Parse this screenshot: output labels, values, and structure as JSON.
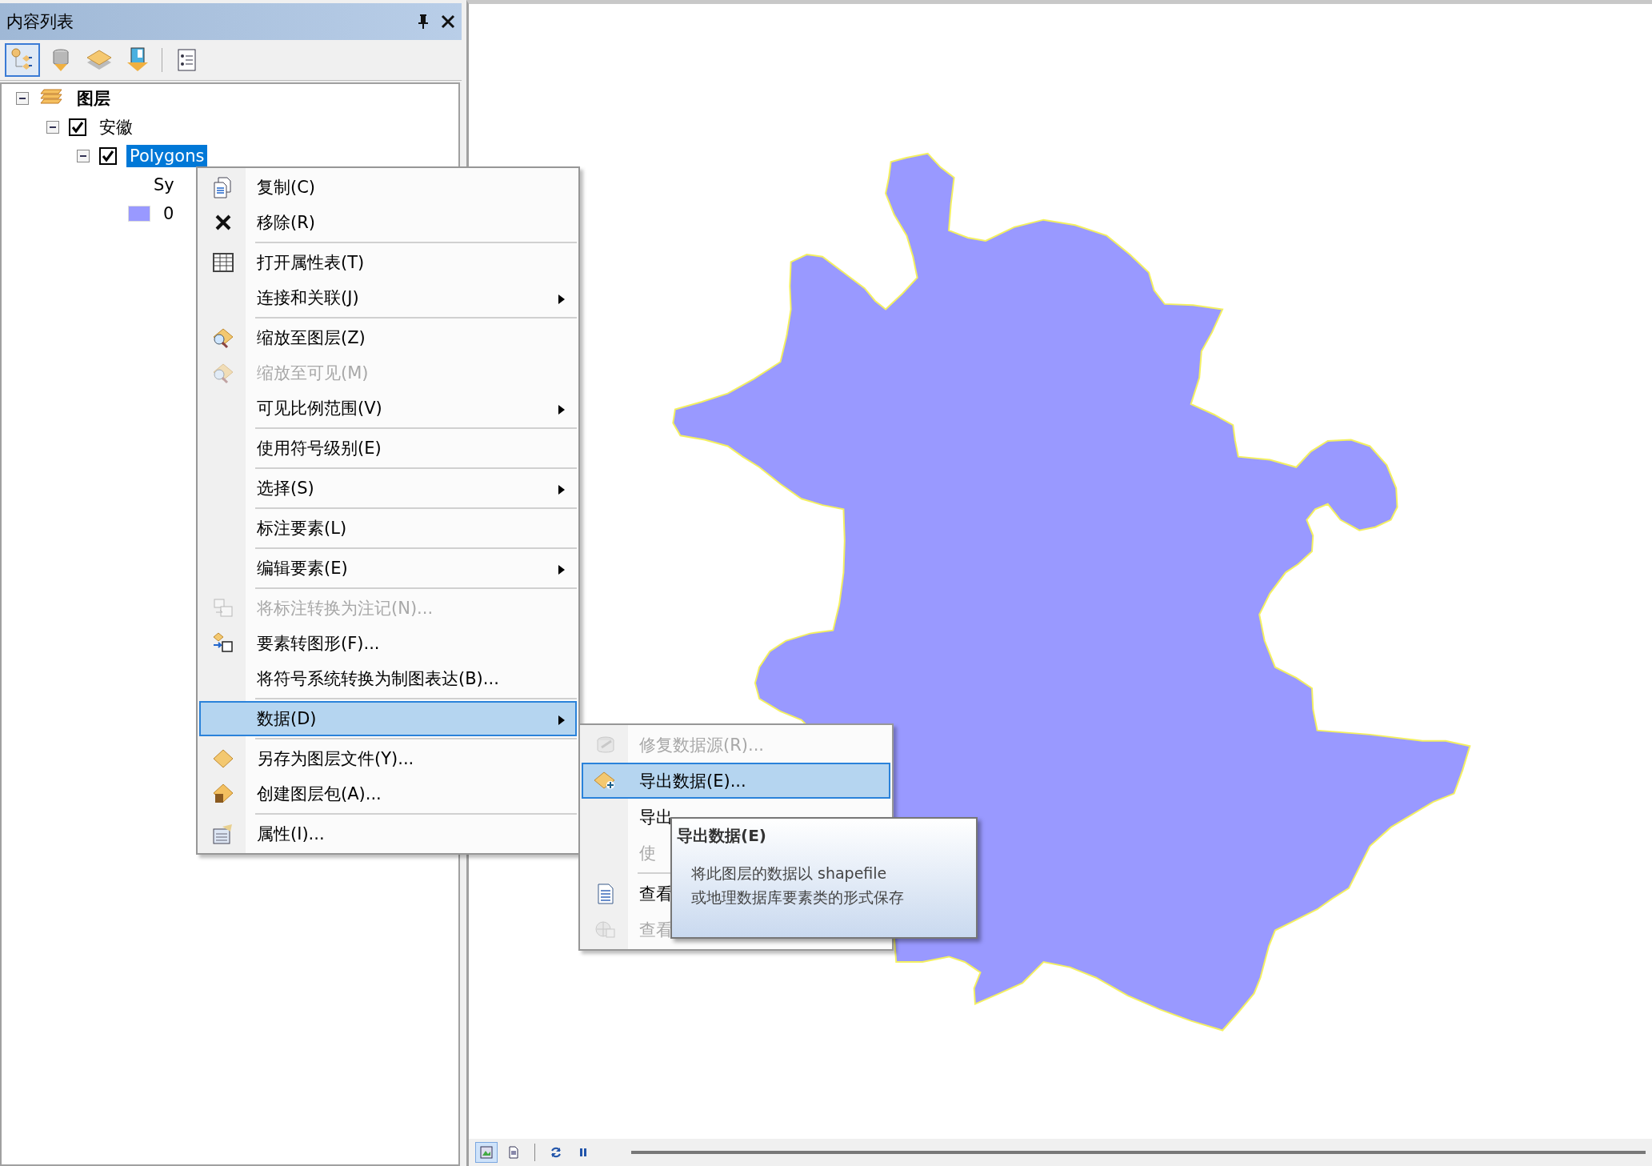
{
  "panel": {
    "title": "内容列表",
    "tools": [
      {
        "selected": true
      },
      {
        "selected": false
      },
      {
        "selected": false
      },
      {
        "selected": false
      },
      {
        "selected": false
      }
    ]
  },
  "tree": [
    {
      "kind": "group",
      "label": "图层",
      "expanded": true,
      "children": [
        {
          "kind": "layer",
          "label": "安徽",
          "checked": true,
          "expanded": true,
          "children": [
            {
              "kind": "layer",
              "label": "Polygons",
              "checked": true,
              "selected": true,
              "expanded": true,
              "children": [
                {
                  "kind": "text",
                  "label": "Sy"
                },
                {
                  "kind": "legend",
                  "label": "0",
                  "color": "#9999ff"
                }
              ]
            }
          ]
        }
      ]
    }
  ],
  "context_menu": [
    {
      "label": "复制(C)",
      "disabled": false,
      "submenu": false,
      "selected": false,
      "separator_before": false
    },
    {
      "label": "移除(R)",
      "disabled": false,
      "submenu": false,
      "selected": false,
      "separator_before": false
    },
    {
      "label": "打开属性表(T)",
      "disabled": false,
      "submenu": false,
      "selected": false,
      "separator_before": true
    },
    {
      "label": "连接和关联(J)",
      "disabled": false,
      "submenu": true,
      "selected": false,
      "separator_before": false
    },
    {
      "label": "缩放至图层(Z)",
      "disabled": false,
      "submenu": false,
      "selected": false,
      "separator_before": true
    },
    {
      "label": "缩放至可见(M)",
      "disabled": true,
      "submenu": false,
      "selected": false,
      "separator_before": false
    },
    {
      "label": "可见比例范围(V)",
      "disabled": false,
      "submenu": true,
      "selected": false,
      "separator_before": false
    },
    {
      "label": "使用符号级别(E)",
      "disabled": false,
      "submenu": false,
      "selected": false,
      "separator_before": true
    },
    {
      "label": "选择(S)",
      "disabled": false,
      "submenu": true,
      "selected": false,
      "separator_before": true
    },
    {
      "label": "标注要素(L)",
      "disabled": false,
      "submenu": false,
      "selected": false,
      "separator_before": true
    },
    {
      "label": "编辑要素(E)",
      "disabled": false,
      "submenu": true,
      "selected": false,
      "separator_before": true
    },
    {
      "label": "将标注转换为注记(N)...",
      "disabled": true,
      "submenu": false,
      "selected": false,
      "separator_before": true
    },
    {
      "label": "要素转图形(F)...",
      "disabled": false,
      "submenu": false,
      "selected": false,
      "separator_before": false
    },
    {
      "label": "将符号系统转换为制图表达(B)...",
      "disabled": false,
      "submenu": false,
      "selected": false,
      "separator_before": false
    },
    {
      "label": "数据(D)",
      "disabled": false,
      "submenu": true,
      "selected": true,
      "separator_before": true
    },
    {
      "label": "另存为图层文件(Y)...",
      "disabled": false,
      "submenu": false,
      "selected": false,
      "separator_before": true
    },
    {
      "label": "创建图层包(A)...",
      "disabled": false,
      "submenu": false,
      "selected": false,
      "separator_before": false
    },
    {
      "label": "属性(I)...",
      "disabled": false,
      "submenu": false,
      "selected": false,
      "separator_before": true
    }
  ],
  "submenu": [
    {
      "label": "修复数据源(R)...",
      "disabled": true,
      "selected": false,
      "separator_before": false
    },
    {
      "label": "导出数据(E)...",
      "disabled": false,
      "selected": true,
      "separator_before": false
    },
    {
      "label": "导出",
      "disabled": false,
      "selected": false,
      "separator_before": false
    },
    {
      "label": "使",
      "disabled": true,
      "selected": false,
      "separator_before": false
    },
    {
      "label": "查看",
      "disabled": false,
      "selected": false,
      "separator_before": true
    },
    {
      "label": "查看",
      "disabled": true,
      "selected": false,
      "separator_before": false
    }
  ],
  "tooltip": {
    "title": "导出数据(E)",
    "lines": [
      "将此图层的数据以 shapefile",
      "或地理数据库要素类的形式保存"
    ]
  },
  "status_bar": {
    "tools": [
      {
        "selected": true
      },
      {
        "selected": false
      },
      {
        "selected": false
      },
      {
        "selected": false
      }
    ]
  }
}
